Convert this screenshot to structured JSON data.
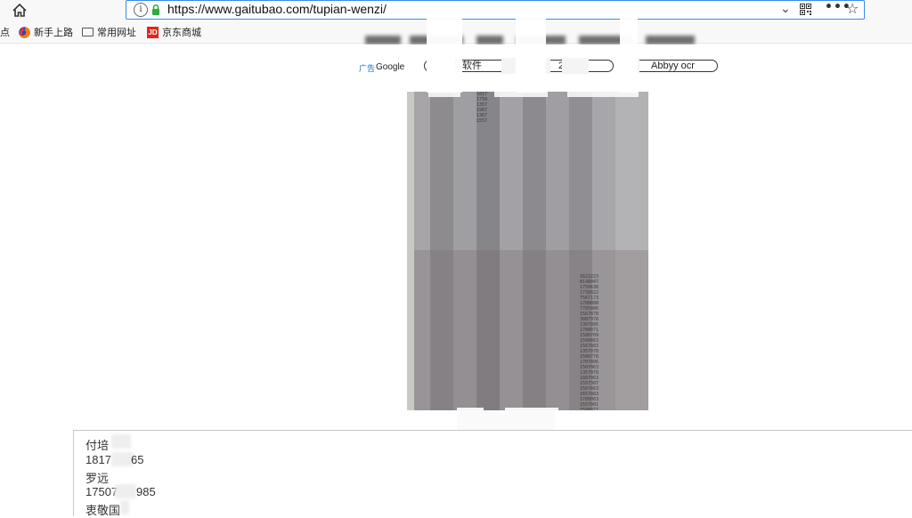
{
  "browser": {
    "home_icon": "home-icon",
    "url": "https://www.gaitubao.com/tupian-wenzi/",
    "info_glyph": "i",
    "chevron": "⌄",
    "more": "•••",
    "star": "☆"
  },
  "bookmarks": {
    "items": [
      {
        "label": "点",
        "icon": "none"
      },
      {
        "label": "新手上路",
        "icon": "firefox-icon"
      },
      {
        "label": "常用网址",
        "icon": "folder-icon"
      },
      {
        "label": "京东商城",
        "icon": "jd-icon",
        "icon_text": "JD"
      }
    ]
  },
  "ad": {
    "label": "广告",
    "provider": "Google",
    "pills": [
      {
        "visible_text": "载软件",
        "trailing": "2"
      },
      {
        "visible_text": "Abbyy ocr"
      }
    ]
  },
  "ocr_result": {
    "lines": [
      {
        "visible": "付培"
      },
      {
        "visible_left": "1817",
        "visible_right": "65"
      },
      {
        "visible": "罗远"
      },
      {
        "visible_left": "17507",
        "visible_right": "985"
      },
      {
        "visible": "衷敬国"
      }
    ]
  },
  "image_text": {
    "column_a": "1817\n1750\n1357\n1967\n1367\n1557",
    "column_b": "1623223\n8148047\n1750638\n1738822\n7567173\n1788888\n7785806\n1567878\n3087978\n1307895\n1780071\n1580709\n1590863\n1567883\n1357078\n1580778\n1707806\n1507063\n1357078\n1807063\n1557307\n1567863\n1657883\n1780063\n1557001\n1588877"
  },
  "colors": {
    "url_border": "#3a8be6",
    "lock_green": "#2cab3f",
    "ad_blue": "#1a73c8",
    "jd_red": "#e1251b"
  }
}
